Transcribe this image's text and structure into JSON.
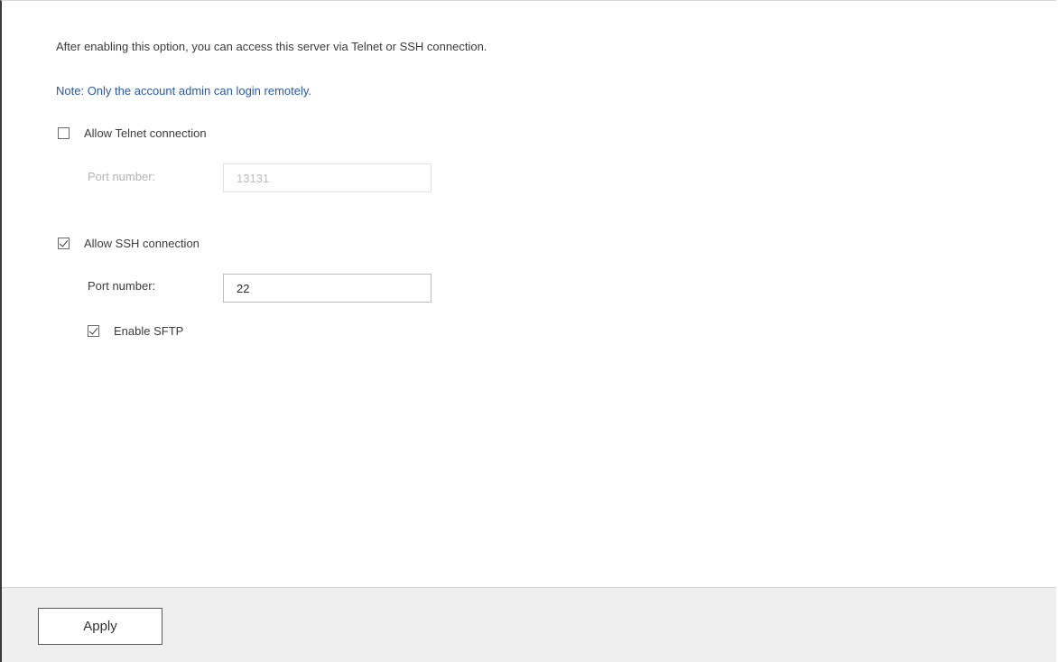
{
  "description": "After enabling this option, you can access this server via Telnet or SSH connection.",
  "note": {
    "prefix": "Note:",
    "text": " Only the account admin can login remotely."
  },
  "telnet": {
    "label": "Allow Telnet connection",
    "checked": false,
    "port_label": "Port number:",
    "port_value": "13131",
    "enabled": false
  },
  "ssh": {
    "label": "Allow SSH connection",
    "checked": true,
    "port_label": "Port number:",
    "port_value": "22",
    "enabled": true
  },
  "sftp": {
    "label": "Enable SFTP",
    "checked": true
  },
  "footer": {
    "apply_label": "Apply"
  }
}
